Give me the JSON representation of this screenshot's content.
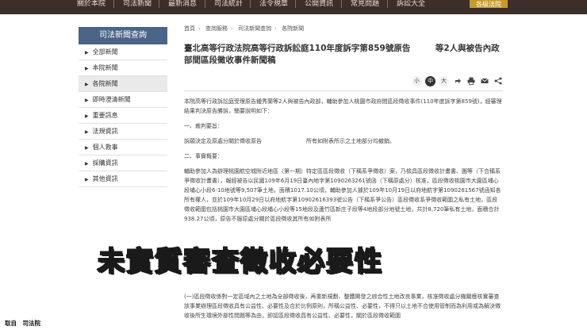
{
  "topnav": {
    "items": [
      "關於本院",
      "司法新聞",
      "最新消息",
      "司法統計",
      "法令規章",
      "公開資訊",
      "常見問題",
      "訴訟大全",
      "各級法院"
    ],
    "highlight": "各級法院"
  },
  "sidebar": {
    "title": "司法新聞查詢",
    "items": [
      {
        "label": "全部新聞",
        "active": false
      },
      {
        "label": "本院新聞",
        "active": false
      },
      {
        "label": "各院新聞",
        "active": true
      },
      {
        "label": "即時澄清新聞",
        "active": false
      },
      {
        "label": "重要訊息",
        "active": false
      },
      {
        "label": "法規資訊",
        "active": false
      },
      {
        "label": "個人救事",
        "active": false
      },
      {
        "label": "採購資訊",
        "active": false
      },
      {
        "label": "其他資訊",
        "active": false
      }
    ]
  },
  "breadcrumb": [
    "首頁",
    "查詢服務",
    "司法新聞查詢",
    "各院新聞"
  ],
  "page_title": "臺北高等行政法院高等行政訴訟庭110年度訴字第859號原告　　　等2人與被告內政部間區段徵收事件新聞稿",
  "font_buttons": [
    "小",
    "中",
    "大"
  ],
  "font_active": "中",
  "toolbar_icons": [
    "share-icon",
    "print-icon",
    "mail-icon",
    "share-network-icon"
  ],
  "body": [
    "本院高等行政訴訟庭受理原告鍾秀蘭等2人與被告內政部，輔助參加人桃園市政府間區段徵收事件(110年度訴字第859號)，經審理結果判決原告勝訴，簡要說明如下：",
    "一、裁判要旨：",
    "訴願決定及原處分關於徵收原告　　　　　　　　所有如附表所示之土地部分均撤銷。",
    "二、事實概要：",
    "輔助參加人為辦理桃園航空城附近地區（第一期）特定區區段徵收（下稱系爭徵收）案，乃檢具區段徵收計畫書、圖等（下合稱系爭徵收計畫書），報經被告以民國109年6月19日臺內地字第1090263261號函（下稱原處分）核准，區段徵收桃園市大園區埔心段埔心小段6-10地號等9,507筆土地，面積1017.10公頃，輔助參加人據於109年10月19日以府地航字第1090261567號函知各所有權人，並於109年10月29日以府地航字第10902616393號公告（下稱系爭公告）區段徵收系爭徵收範圍之私有土地，區段徵收範圍包括桃園市大園區埔心段埔心小段等15地段及蘆竹區新庄子段等4地段部分地號土地，共計8,720筆私有土地，面積合計938.27公頃，原告不服原處分關於區段徵收其所有如附表所"
  ],
  "caption": "未實質審查徵收必要性",
  "lower": "(一)區段徵收係對一定區域內之土地為全部徵收後，再重新規劃、整體開發之綜合性土地改良事業，核准徵收處分機關應核實審查該事業辦理區段徵收具有公益性、必要性及合於比例原則，所稱公益性、必要性，不得只以土地不合使用管制而為利用或為解決徵收後所生環境外部性問題等為由，即認區段徵收具有公益性、必要性，關於區段徵收範圍",
  "source": "取自　司法院"
}
